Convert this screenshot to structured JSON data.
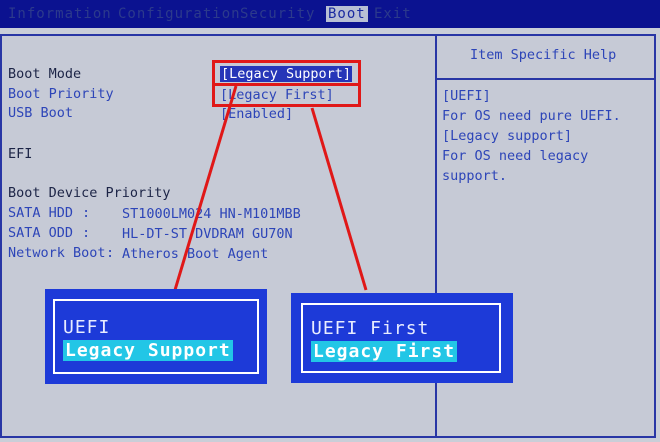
{
  "menu": {
    "items": [
      {
        "label": "Information",
        "active": false
      },
      {
        "label": "Configuration",
        "active": false
      },
      {
        "label": "Security",
        "active": false
      },
      {
        "label": "Boot",
        "active": true
      },
      {
        "label": "Exit",
        "active": false
      }
    ]
  },
  "settings": {
    "boot_mode_label": "Boot Mode",
    "boot_mode_value": "[Legacy Support]",
    "boot_priority_label": "Boot Priority",
    "boot_priority_value": "[Legacy First]",
    "usb_boot_label": "USB Boot",
    "usb_boot_value": "[Enabled]",
    "efi_label": "EFI",
    "device_priority_title": "Boot Device Priority",
    "devices": [
      {
        "name": "SATA HDD",
        "sep": "   :",
        "desc": "ST1000LM024 HN-M101MBB"
      },
      {
        "name": "SATA ODD",
        "sep": "   :",
        "desc": "HL-DT-ST DVDRAM GU70N"
      },
      {
        "name": "Network Boot",
        "sep": ":",
        "desc": "Atheros Boot Agent"
      }
    ]
  },
  "help": {
    "title": "Item Specific Help",
    "lines": [
      "[UEFI]",
      "For OS need pure UEFI.",
      "[Legacy support]",
      "For OS need legacy",
      "support."
    ]
  },
  "popup_boot_mode": {
    "options": [
      "UEFI",
      "Legacy Support"
    ],
    "selected": "Legacy Support"
  },
  "popup_boot_priority": {
    "options": [
      "UEFI First",
      "Legacy First"
    ],
    "selected": "Legacy First"
  },
  "colors": {
    "annotation": "#e01818",
    "popup_bg": "#1d3ad8",
    "highlight": "#22c6e6",
    "menubar": "#0b1290"
  }
}
